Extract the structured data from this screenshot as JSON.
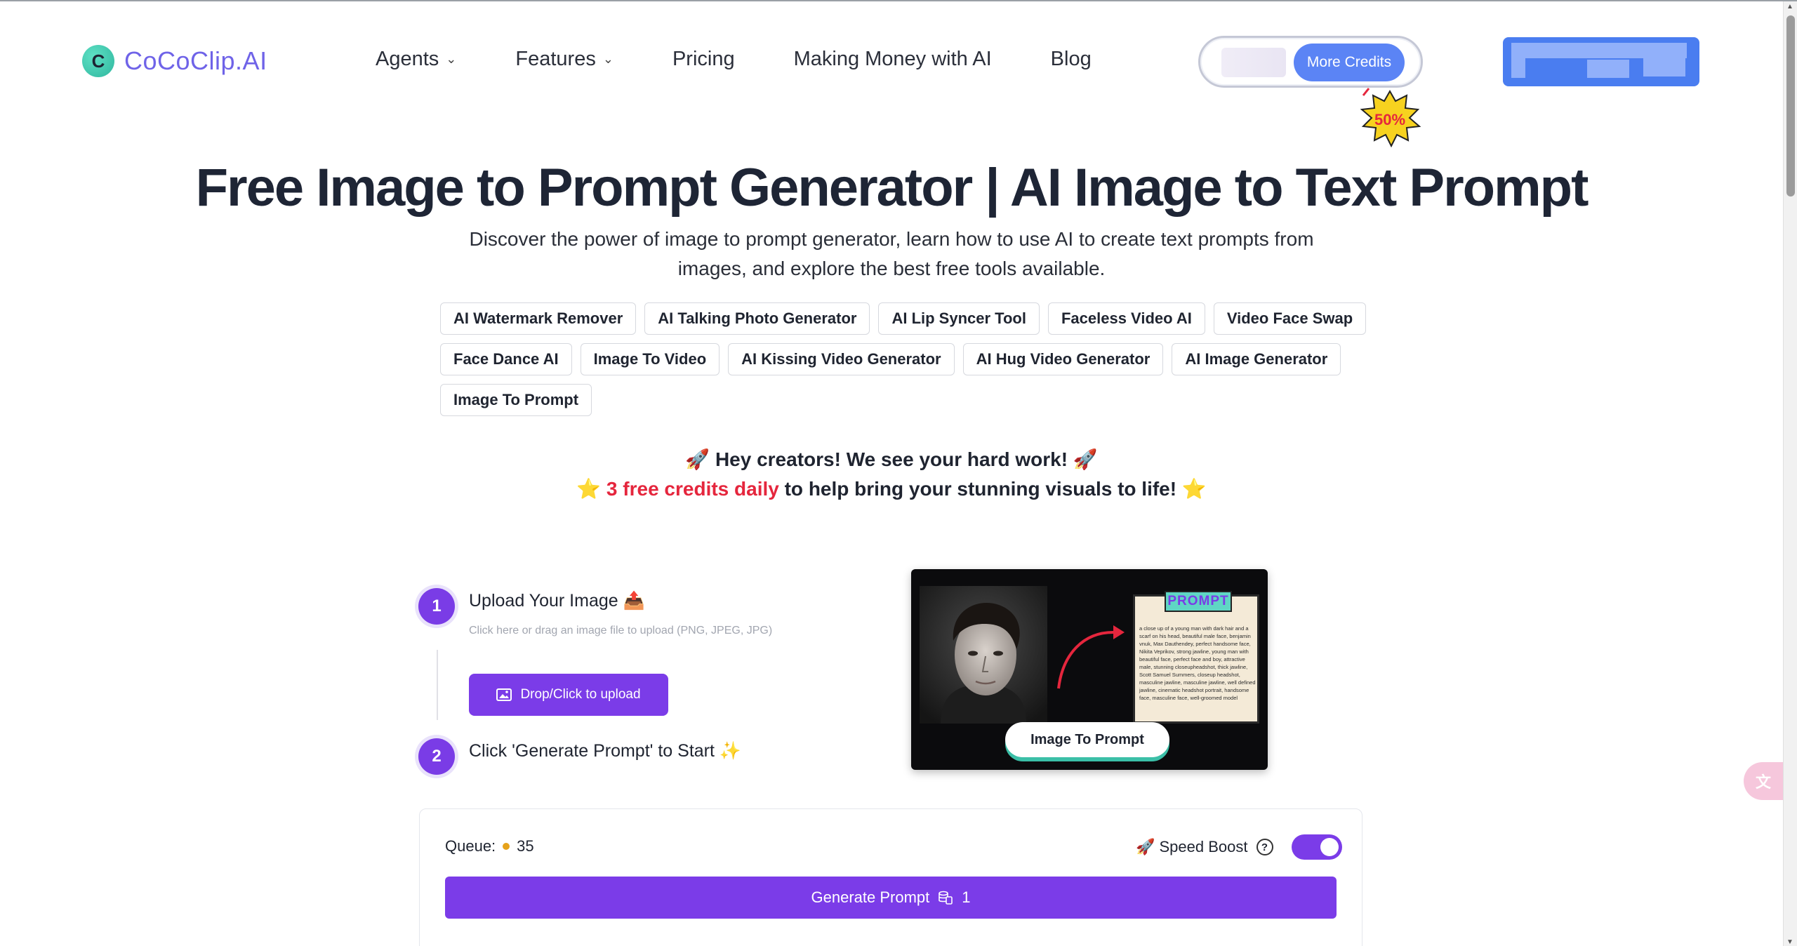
{
  "brand": {
    "name": "CoCoClip.AI",
    "logo_letter": "C"
  },
  "nav": [
    {
      "label": "Agents",
      "dropdown": true
    },
    {
      "label": "Features",
      "dropdown": true
    },
    {
      "label": "Pricing",
      "dropdown": false
    },
    {
      "label": "Making Money with AI",
      "dropdown": false
    },
    {
      "label": "Blog",
      "dropdown": false
    }
  ],
  "credits": {
    "more_label": "More Credits",
    "badge_text": "50%"
  },
  "hero": {
    "title": "Free Image to Prompt Generator | AI Image to Text Prompt",
    "subtitle": "Discover the power of image to prompt generator, learn how to use AI to create text prompts from images, and explore the best free tools available."
  },
  "tags": [
    [
      "AI Watermark Remover",
      "AI Talking Photo Generator",
      "AI Lip Syncer Tool",
      "Faceless Video AI",
      "Video Face Swap"
    ],
    [
      "Face Dance AI",
      "Image To Video",
      "AI Kissing Video Generator",
      "AI Hug Video Generator",
      "AI Image Generator"
    ],
    [
      "Image To Prompt"
    ]
  ],
  "promo": {
    "line1": "🚀 Hey creators! We see your hard work! 🚀",
    "line2_highlight": "3 free credits daily",
    "line2_rest": " to help bring your stunning visuals to life! ",
    "star": "⭐"
  },
  "steps": {
    "step1": {
      "num": "1",
      "title": "Upload Your Image 📤",
      "hint": "Click here or drag an image file to upload (PNG, JPEG, JPG)",
      "button": "Drop/Click to upload"
    },
    "step2": {
      "num": "2",
      "title": "Click 'Generate Prompt' to Start ✨"
    }
  },
  "preview": {
    "label": "PROMPT",
    "prompt_text": "a close up of a young man with dark hair and a scarf on his head, beautiful male face, benjamin vnuk, Max Dauthendey, perfect handsome face, Nikita Veprikov, strong jawline, young man with beautiful face, perfect face and boy, attractive male, stunning closeupheadshot, thick jawline, Scott Samuel Summers, closeup headshot, masculine jawline, masculine jawline, well defined jawline, cinematic headshot portrait, handsome face, masculine face, well-groomed model",
    "button": "Image To Prompt"
  },
  "generate": {
    "queue_label": "Queue:",
    "queue_value": "35",
    "speed_label": "🚀 Speed Boost",
    "help": "?",
    "speed_on": true,
    "button_label": "Generate Prompt",
    "button_cost": "1"
  },
  "colors": {
    "primary": "#7b3ce8",
    "blue": "#5b84f5",
    "highlight": "#e5263d",
    "logo_text": "#6f63e8"
  },
  "icons": {
    "translate": "translate-icon",
    "upload": "image-icon",
    "coin": "coin-stack-icon"
  }
}
